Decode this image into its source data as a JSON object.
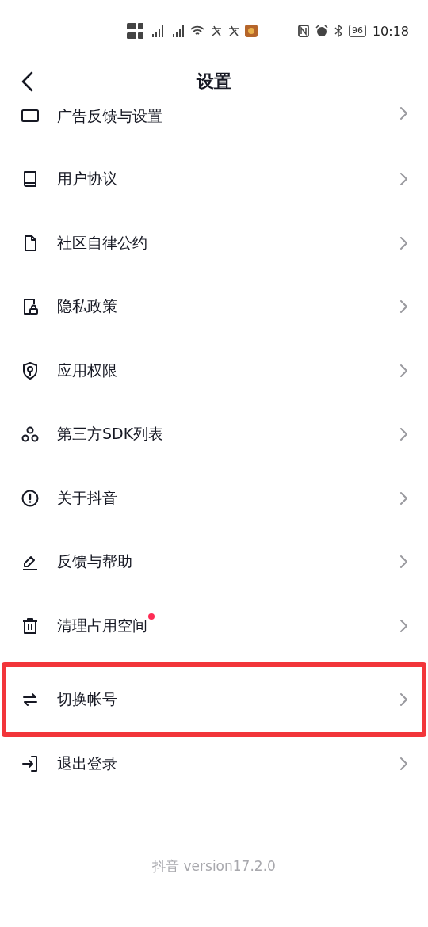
{
  "status_bar": {
    "time": "10:18",
    "battery": "96"
  },
  "header": {
    "title": "设置"
  },
  "items": [
    {
      "label": "广告反馈与设置",
      "dot": false,
      "highlighted": false
    },
    {
      "label": "用户协议",
      "dot": false,
      "highlighted": false
    },
    {
      "label": "社区自律公约",
      "dot": false,
      "highlighted": false
    },
    {
      "label": "隐私政策",
      "dot": false,
      "highlighted": false
    },
    {
      "label": "应用权限",
      "dot": false,
      "highlighted": false
    },
    {
      "label": "第三方SDK列表",
      "dot": false,
      "highlighted": false
    },
    {
      "label": "关于抖音",
      "dot": false,
      "highlighted": false
    },
    {
      "label": "反馈与帮助",
      "dot": false,
      "highlighted": false
    },
    {
      "label": "清理占用空间",
      "dot": true,
      "highlighted": false
    },
    {
      "label": "切换帐号",
      "dot": false,
      "highlighted": true
    },
    {
      "label": "退出登录",
      "dot": false,
      "highlighted": false
    }
  ],
  "footer": "抖音 version17.2.0"
}
